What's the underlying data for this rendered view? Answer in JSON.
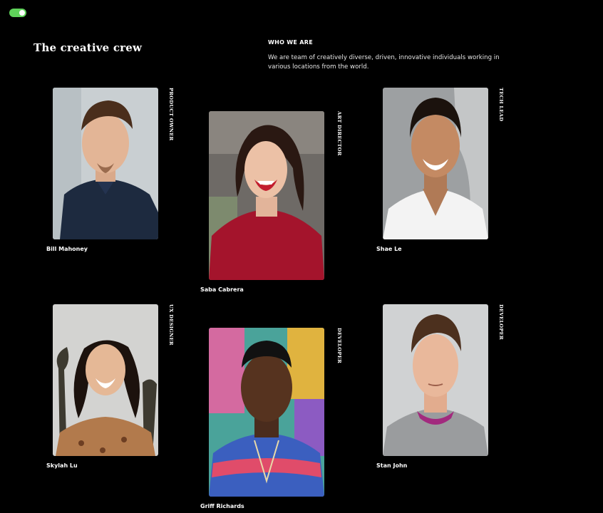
{
  "header": {
    "title": "The creative crew",
    "who_heading": "WHO WE ARE",
    "who_text": "We are team of creatively diverse, driven, innovative individuals working in various locations from the world."
  },
  "theme_toggle": {
    "state": "on",
    "color": "#5fd35a"
  },
  "team": [
    {
      "name": "Bill Mahoney",
      "role": "PRODUCT OWNER",
      "photo": "portrait-man-navy-polo"
    },
    {
      "name": "Saba Cabrera",
      "role": "ART DIRECTOR",
      "photo": "portrait-woman-red-sweater"
    },
    {
      "name": "Shae Le",
      "role": "TECH LEAD",
      "photo": "portrait-man-white-tshirt"
    },
    {
      "name": "Skylah Lu",
      "role": "UX DESIGNER",
      "photo": "portrait-woman-floral-top"
    },
    {
      "name": "Griff Richards",
      "role": "DEVELOPER",
      "photo": "portrait-man-striped-shirt"
    },
    {
      "name": "Stan John",
      "role": "DEVELOPER",
      "photo": "portrait-man-grey-sweater"
    }
  ]
}
